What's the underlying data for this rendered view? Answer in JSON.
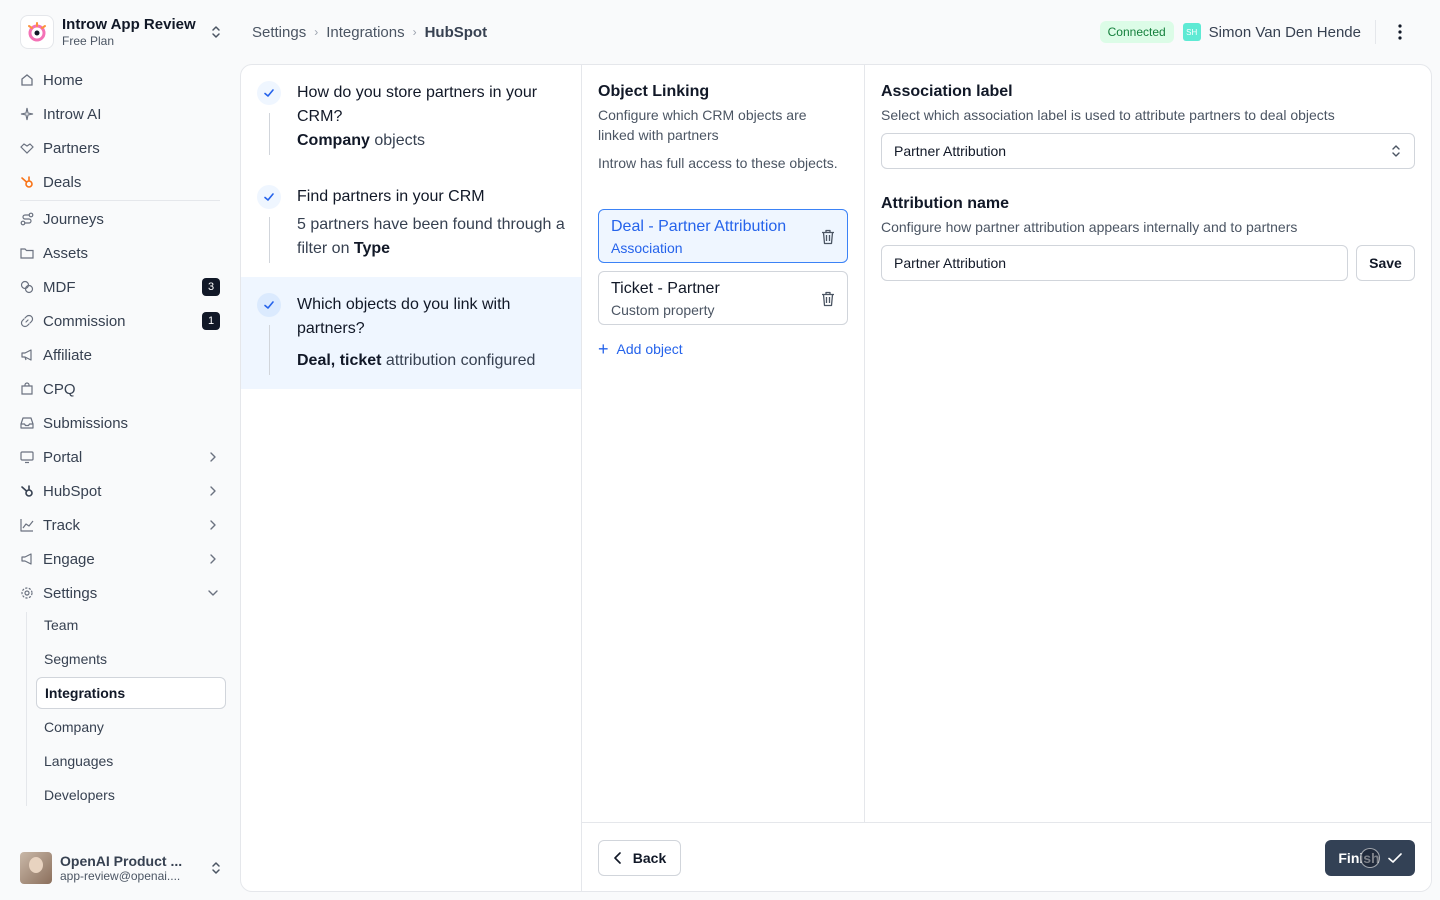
{
  "workspace": {
    "name": "Introw App Review",
    "plan": "Free Plan"
  },
  "nav": {
    "home": "Home",
    "introw_ai": "Introw AI",
    "partners": "Partners",
    "deals": "Deals",
    "journeys": "Journeys",
    "assets": "Assets",
    "mdf": "MDF",
    "mdf_badge": "3",
    "commission": "Commission",
    "commission_badge": "1",
    "affiliate": "Affiliate",
    "cpq": "CPQ",
    "submissions": "Submissions",
    "portal": "Portal",
    "hubspot": "HubSpot",
    "track": "Track",
    "engage": "Engage",
    "settings": "Settings",
    "settings_sub": [
      "Team",
      "Segments",
      "Integrations",
      "Company",
      "Languages",
      "Developers"
    ]
  },
  "account": {
    "name": "OpenAI Product ...",
    "email": "app-review@openai...."
  },
  "breadcrumb": [
    "Settings",
    "Integrations",
    "HubSpot"
  ],
  "header": {
    "status": "Connected",
    "user_initials": "SH",
    "user_name": "Simon Van Den Hende"
  },
  "steps": [
    {
      "title": "How do you store partners in your CRM?",
      "desc_bold": "Company",
      "desc_rest": " objects"
    },
    {
      "title": "Find partners in your CRM",
      "desc_pre": "5 partners have been found through a filter on ",
      "desc_bold": "Type"
    },
    {
      "title": "Which objects do you link with partners?",
      "desc_bold": "Deal, ticket",
      "desc_rest": " attribution configured"
    }
  ],
  "object_linking": {
    "title": "Object Linking",
    "desc": "Configure which CRM objects are linked with partners",
    "access_note": "Introw has full access to these objects.",
    "objects": [
      {
        "title": "Deal - Partner Attribution",
        "type": "Association"
      },
      {
        "title": "Ticket - Partner",
        "type": "Custom property"
      }
    ],
    "add_label": "Add object"
  },
  "association": {
    "title": "Association label",
    "desc": "Select which association label is used to attribute partners to deal objects",
    "selected": "Partner Attribution"
  },
  "attribution": {
    "title": "Attribution name",
    "desc": "Configure how partner attribution appears internally and to partners",
    "value": "Partner Attribution",
    "save_label": "Save"
  },
  "footer": {
    "back_label": "Back",
    "finish_label": "Finish"
  },
  "colors": {
    "accent": "#2563eb",
    "hubspot": "#f97316",
    "primary_button": "#334155",
    "connected_bg": "#dcfce7"
  }
}
